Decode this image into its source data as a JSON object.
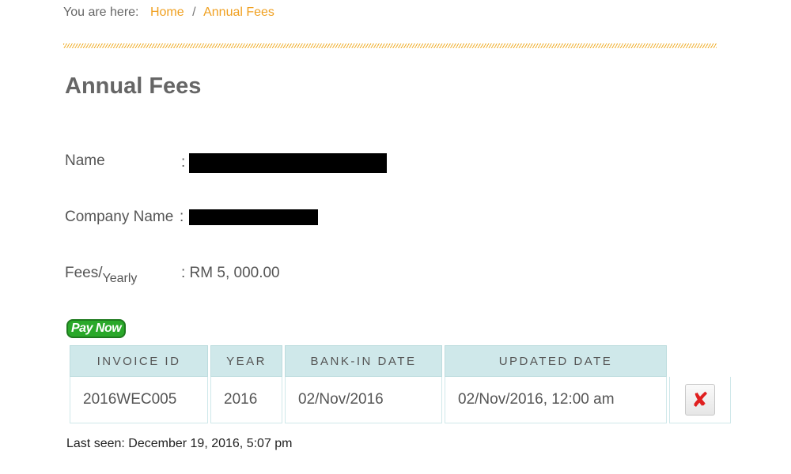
{
  "breadcrumb": {
    "prefix": "You are here:",
    "home_label": "Home",
    "separator": "/",
    "current_label": "Annual Fees"
  },
  "page": {
    "title": "Annual Fees"
  },
  "fields": {
    "name_label": "Name",
    "colon": ":",
    "company_label": "Company Name",
    "fees_label": "Fees/",
    "fees_sub_label": "Yearly",
    "fees_value": ": RM 5, 000.00"
  },
  "pay_now": {
    "label": "Pay Now"
  },
  "table": {
    "columns": [
      "INVOICE ID",
      "YEAR",
      "BANK-IN DATE",
      "UPDATED DATE"
    ],
    "rows": [
      {
        "invoice_id": "2016WEC005",
        "year": "2016",
        "bank_in_date": "02/Nov/2016",
        "updated_date": "02/Nov/2016, 12:00 am",
        "action_icon": "red-x-icon"
      }
    ]
  },
  "footer": {
    "last_seen": "Last seen: December 19, 2016, 5:07 pm"
  },
  "colors": {
    "accent": "#f0a020",
    "table_header_bg": "#cfe8ea",
    "pay_now_bg": "#2aa82a",
    "delete_icon": "#e02020"
  }
}
